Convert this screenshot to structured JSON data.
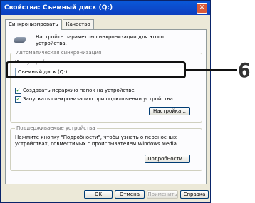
{
  "window": {
    "title": "Свойства: Съемный диск (Q:)",
    "close_glyph": "✕"
  },
  "tabs": [
    {
      "label": "Синхронизировать"
    },
    {
      "label": "Качество"
    }
  ],
  "intro_text": "Настройте параметры синхронизации для этого устройства.",
  "auto_sync": {
    "group_title": "Автоматическая синхронизация",
    "device_name_label": "Имя устройства:",
    "device_name_value": "Съемный диск (Q:)",
    "option1": {
      "label": "Создавать иерархию папок на устройстве",
      "checked": true
    },
    "option2": {
      "label": "Запускать синхронизацию при подключении устройства",
      "checked": true
    },
    "settings_button": "Настройка..."
  },
  "supported": {
    "group_title": "Поддерживаемые устройства",
    "text": "Нажмите кнопку \"Подробности\", чтобы узнать о переносных устройствах, совместимых с проигрывателем Windows Media.",
    "details_button": "Подробности..."
  },
  "footer": {
    "ok": "OK",
    "cancel": "Отмена",
    "apply": "Применить",
    "help": "Справка"
  },
  "callout": {
    "number": "6"
  },
  "colors": {
    "titlebar": "#0a58d8",
    "dialog_bg": "#ece9d8",
    "check": "#21a121"
  }
}
